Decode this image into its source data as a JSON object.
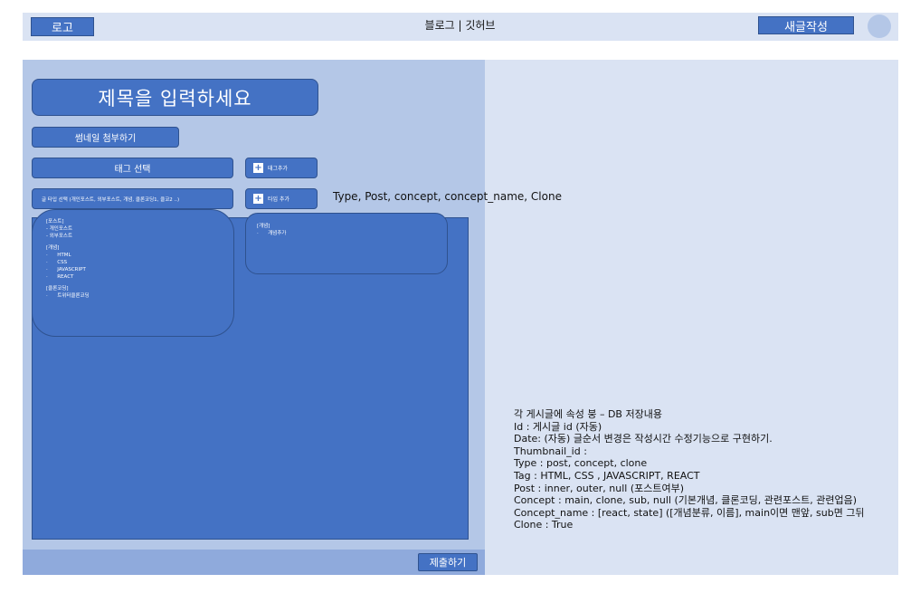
{
  "header": {
    "logo_label": "로고",
    "site_title": "블로그 | 깃허브",
    "new_post_label": "새글작성"
  },
  "editor": {
    "title_placeholder": "제목을 입력하세요",
    "thumbnail_button": "썸네일 첨부하기",
    "tag_select_label": "태그 선택",
    "tag_add_label": "태그추가",
    "type_select_label": "글 타입 선택 (개인포스트, 외부포스트, 개념, 클론코딩1, 클코2 ..)",
    "type_add_label": "타입 추가",
    "plus_symbol": "+",
    "type_note": "Type, Post, concept, concept_name, Clone",
    "submit_label": "제출하기"
  },
  "type_popup": {
    "groups": [
      {
        "heading": "[포스트]",
        "items": [
          "- 개인포스트",
          "- 외부포스트"
        ]
      },
      {
        "heading": "[개념]",
        "items": [
          "·      HTML",
          "·      CSS",
          "·      JAVASCRIPT",
          "·      REACT"
        ]
      },
      {
        "heading": "[클론코딩]",
        "items": [
          "·      트위터클론코딩"
        ]
      }
    ]
  },
  "concept_popup": {
    "heading": "[개념]",
    "items": [
      "·      개념추가"
    ]
  },
  "info_note": {
    "lines": [
      "각 게시글에 속성 붕 – DB 저장내용",
      "Id : 게시글 id (자동)",
      "Date: (자동) 글순서 변경은 작성시간 수정기능으로 구현하기.",
      "Thumbnail_id :",
      "Type : post, concept, clone",
      "Tag : HTML, CSS , JAVASCRIPT, REACT",
      "Post : inner, outer, null (포스트여부)",
      "Concept : main, clone, sub, null (기본개념, 클론코딩, 관련포스트, 관련업음)",
      "Concept_name : [react, state]  ([개념분류, 이름], main이면 맨앞, sub면 그뒤",
      "Clone : True"
    ]
  },
  "colors": {
    "accent": "#4472c4",
    "header_bg": "#dae3f3",
    "panel_bg": "#b4c7e7",
    "bottom_bar": "#8faadc"
  }
}
